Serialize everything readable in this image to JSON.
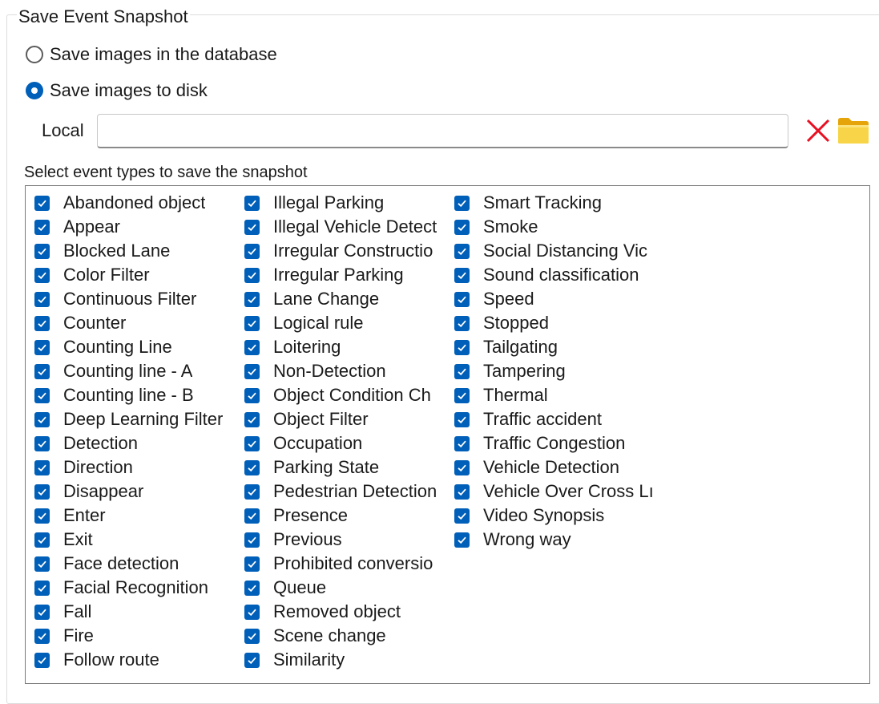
{
  "group_title": "Save Event Snapshot",
  "storage": {
    "option_db": "Save images in the database",
    "option_disk": "Save images to disk",
    "selected": "disk"
  },
  "local": {
    "label": "Local",
    "value": "",
    "placeholder": ""
  },
  "event_list": {
    "label": "Select event types to save the snapshot",
    "columns": [
      [
        {
          "label": "Abandoned object",
          "checked": true
        },
        {
          "label": "Appear",
          "checked": true
        },
        {
          "label": "Blocked Lane",
          "checked": true
        },
        {
          "label": "Color Filter",
          "checked": true
        },
        {
          "label": "Continuous Filter",
          "checked": true
        },
        {
          "label": "Counter",
          "checked": true
        },
        {
          "label": "Counting Line",
          "checked": true
        },
        {
          "label": "Counting line - A",
          "checked": true
        },
        {
          "label": "Counting line - B",
          "checked": true
        },
        {
          "label": "Deep Learning Filter",
          "checked": true
        },
        {
          "label": "Detection",
          "checked": true
        },
        {
          "label": "Direction",
          "checked": true
        },
        {
          "label": "Disappear",
          "checked": true
        },
        {
          "label": "Enter",
          "checked": true
        },
        {
          "label": "Exit",
          "checked": true
        },
        {
          "label": "Face detection",
          "checked": true
        },
        {
          "label": "Facial Recognition",
          "checked": true
        },
        {
          "label": "Fall",
          "checked": true
        },
        {
          "label": "Fire",
          "checked": true
        },
        {
          "label": "Follow route",
          "checked": true
        }
      ],
      [
        {
          "label": "Illegal Parking",
          "checked": true
        },
        {
          "label": "Illegal Vehicle Detect",
          "checked": true
        },
        {
          "label": "Irregular Constructio",
          "checked": true
        },
        {
          "label": "Irregular Parking",
          "checked": true
        },
        {
          "label": "Lane Change",
          "checked": true
        },
        {
          "label": "Logical rule",
          "checked": true
        },
        {
          "label": "Loitering",
          "checked": true
        },
        {
          "label": "Non-Detection",
          "checked": true
        },
        {
          "label": "Object Condition Ch",
          "checked": true
        },
        {
          "label": "Object Filter",
          "checked": true
        },
        {
          "label": "Occupation",
          "checked": true
        },
        {
          "label": "Parking State",
          "checked": true
        },
        {
          "label": "Pedestrian Detection",
          "checked": true
        },
        {
          "label": "Presence",
          "checked": true
        },
        {
          "label": "Previous",
          "checked": true
        },
        {
          "label": "Prohibited conversio",
          "checked": true
        },
        {
          "label": "Queue",
          "checked": true
        },
        {
          "label": "Removed object",
          "checked": true
        },
        {
          "label": "Scene change",
          "checked": true
        },
        {
          "label": "Similarity",
          "checked": true
        }
      ],
      [
        {
          "label": "Smart Tracking",
          "checked": true
        },
        {
          "label": "Smoke",
          "checked": true
        },
        {
          "label": "Social Distancing Vic",
          "checked": true
        },
        {
          "label": "Sound classification",
          "checked": true
        },
        {
          "label": "Speed",
          "checked": true
        },
        {
          "label": "Stopped",
          "checked": true
        },
        {
          "label": "Tailgating",
          "checked": true
        },
        {
          "label": "Tampering",
          "checked": true
        },
        {
          "label": "Thermal",
          "checked": true
        },
        {
          "label": "Traffic accident",
          "checked": true
        },
        {
          "label": "Traffic Congestion",
          "checked": true
        },
        {
          "label": "Vehicle Detection",
          "checked": true
        },
        {
          "label": "Vehicle Over Cross Lı",
          "checked": true
        },
        {
          "label": "Video Synopsis",
          "checked": true
        },
        {
          "label": "Wrong way",
          "checked": true
        }
      ]
    ]
  },
  "icons": {
    "clear": "close-icon",
    "browse": "folder-icon"
  },
  "colors": {
    "accent": "#005fb8",
    "clear_icon": "#e81123",
    "folder": "#f5c518"
  }
}
